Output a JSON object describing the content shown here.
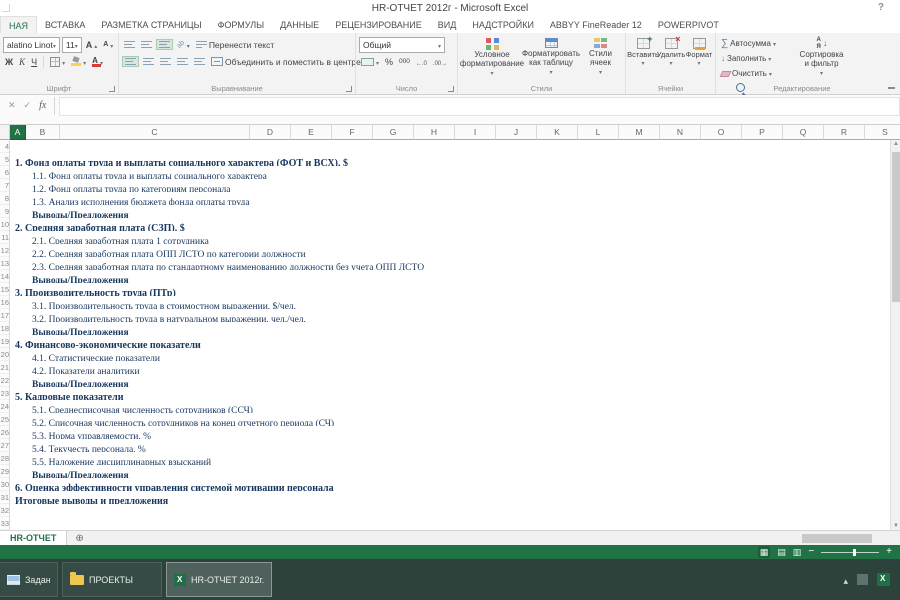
{
  "window": {
    "title": "HR-ОТЧЕТ 2012г - Microsoft Excel",
    "help_icon": "?"
  },
  "ribbon": {
    "tabs": [
      {
        "label": "НАЯ",
        "active": true
      },
      {
        "label": "ВСТАВКА"
      },
      {
        "label": "РАЗМЕТКА СТРАНИЦЫ"
      },
      {
        "label": "ФОРМУЛЫ"
      },
      {
        "label": "ДАННЫЕ"
      },
      {
        "label": "РЕЦЕНЗИРОВАНИЕ"
      },
      {
        "label": "ВИД"
      },
      {
        "label": "НАДСТРОЙКИ"
      },
      {
        "label": "ABBYY FineReader 12"
      },
      {
        "label": "POWERPIVOT"
      }
    ],
    "font": {
      "name": "alatino Linot",
      "size": "11",
      "letter": "А",
      "bold": "Ж",
      "italic": "К",
      "underline": "Ч",
      "label": "Шрифт"
    },
    "alignment": {
      "wrap": "Перенести текст",
      "merge": "Объединить и поместить в центре",
      "label": "Выравнивание"
    },
    "number": {
      "format": "Общий",
      "percent": "%",
      "thousands": "000",
      "label": "Число"
    },
    "styles": {
      "conditional": "Условное форматирование",
      "format_table": "Форматировать как таблицу",
      "cell_styles": "Стили ячеек",
      "label": "Стили"
    },
    "cells": {
      "insert": "Вставить",
      "delete": "Удалить",
      "format": "Формат",
      "label": "Ячейки"
    },
    "editing": {
      "sigma": "∑",
      "autosum": "Автосумма",
      "fill": "Заполнить",
      "clear": "Очистить",
      "sort": "Сортировка и фильтр",
      "find": "Найти и выделить",
      "label": "Редактирование"
    }
  },
  "formula_bar": {
    "cancel": "✕",
    "enter": "✓",
    "fx": "fx",
    "value": ""
  },
  "sheet": {
    "columns": [
      "A",
      "B",
      "C",
      "D",
      "E",
      "F",
      "G",
      "H",
      "I",
      "J",
      "K",
      "L",
      "M",
      "N",
      "O",
      "P",
      "Q",
      "R",
      "S"
    ],
    "selected_column": "A",
    "row_start": 4,
    "tab_name": "HR-ОТЧЕТ",
    "new_sheet_icon": "⊕",
    "rows": [
      {
        "text": "",
        "style": "n",
        "indent": 0
      },
      {
        "text": "1. Фонд оплаты труда и выплаты социального характера (ФОТ и ВСХ), $",
        "style": "b",
        "indent": 0
      },
      {
        "text": "1.1. Фонд оплаты труда и выплаты социального характера",
        "style": "n",
        "indent": 1
      },
      {
        "text": "1.2. Фонд оплаты труда по категориям персонала",
        "style": "n",
        "indent": 1
      },
      {
        "text": "1.3. Анализ исполнения бюджета фонда оплаты труда",
        "style": "n",
        "indent": 1
      },
      {
        "text": "Выводы/Предложения",
        "style": "bu",
        "indent": 1
      },
      {
        "text": "2. Средняя заработная плата (СЗП), $",
        "style": "b",
        "indent": 0
      },
      {
        "text": "2.1. Средняя заработная плата 1 сотрудника",
        "style": "n",
        "indent": 1
      },
      {
        "text": "2.2. Средняя заработная плата ОПП ЛСТО по категории должности",
        "style": "n",
        "indent": 1
      },
      {
        "text": "2.3. Средняя заработная плата по стандартному наименованию должности без учета ОПП ЛСТО",
        "style": "n",
        "indent": 1
      },
      {
        "text": "Выводы/Предложения",
        "style": "bu",
        "indent": 1
      },
      {
        "text": "3. Производительность труда (ПТр)",
        "style": "b",
        "indent": 0
      },
      {
        "text": "3.1. Производительность труда в стоимостном выражении, $/чел.",
        "style": "n",
        "indent": 1
      },
      {
        "text": "3.2. Производительность труда в натуральном выражении, чел./чел.",
        "style": "n",
        "indent": 1
      },
      {
        "text": "Выводы/Предложения",
        "style": "bu",
        "indent": 1
      },
      {
        "text": "4. Финансово-экономические показатели",
        "style": "b",
        "indent": 0
      },
      {
        "text": "4.1. Статистические показатели",
        "style": "n",
        "indent": 1
      },
      {
        "text": "4.2. Показатели аналитики",
        "style": "n",
        "indent": 1
      },
      {
        "text": "Выводы/Предложения",
        "style": "bu",
        "indent": 1
      },
      {
        "text": "5. Кадровые показатели",
        "style": "b",
        "indent": 0
      },
      {
        "text": "5.1. Среднесписочная численность сотрудников (ССЧ)",
        "style": "n",
        "indent": 1
      },
      {
        "text": "5.2. Списочная численность сотрудников на конец отчетного периода (СЧ)",
        "style": "n",
        "indent": 1
      },
      {
        "text": "5.3. Норма управляемости, %",
        "style": "n",
        "indent": 1
      },
      {
        "text": "5.4. Текучесть персонала, %",
        "style": "n",
        "indent": 1
      },
      {
        "text": "5.5. Наложение дисциплинарных взысканий",
        "style": "n",
        "indent": 1
      },
      {
        "text": "Выводы/Предложения",
        "style": "bu",
        "indent": 1
      },
      {
        "text": "6. Оценка эффективности управления системой мотивации персонала",
        "style": "b",
        "indent": 0
      },
      {
        "text": "Итоговые выводы и предложения",
        "style": "bu",
        "indent": 0
      },
      {
        "text": "",
        "style": "n",
        "indent": 0
      },
      {
        "text": "",
        "style": "n",
        "indent": 0
      }
    ]
  },
  "status_bar": {
    "zoom_minus": "−",
    "zoom_plus": "+"
  },
  "taskbar": {
    "items": [
      {
        "label": "Задание для...",
        "icon": "picture-icon"
      },
      {
        "label": "ПРОЕКТЫ",
        "icon": "folder-icon"
      },
      {
        "label": "HR-ОТЧЕТ 2012г...",
        "icon": "excel-icon",
        "active": true
      }
    ]
  }
}
